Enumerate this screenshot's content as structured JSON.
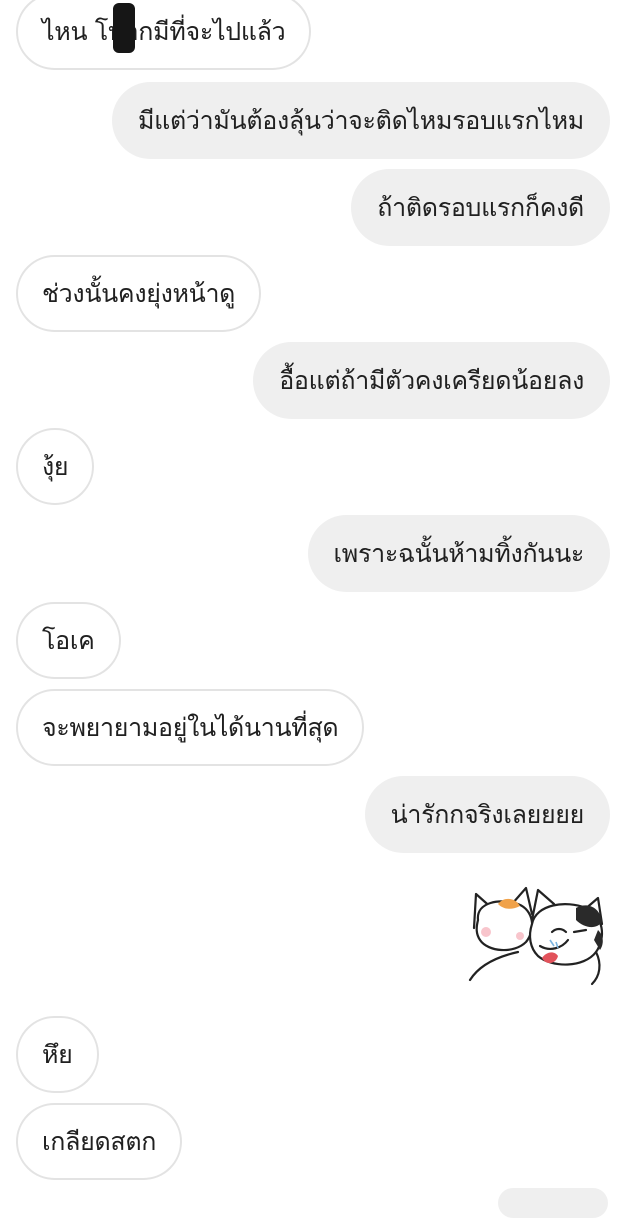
{
  "messages": [
    {
      "side": "in",
      "text": "ไหน โบอกมีที่จะไปแล้ว"
    },
    {
      "side": "out",
      "text": "มีแต่ว่ามันต้องลุ้นว่าจะติดไหมรอบแรกไหม"
    },
    {
      "side": "out",
      "text": "ถ้าติดรอบแรกก็คงดี"
    },
    {
      "side": "in",
      "text": "ช่วงนั้นคงยุ่งหน้าดู"
    },
    {
      "side": "out",
      "text": "อื้อแต่ถ้ามีตัวคงเครียดน้อยลง"
    },
    {
      "side": "in",
      "text": "งุ้ย"
    },
    {
      "side": "out",
      "text": "เพราะฉนั้นห้ามทิ้งกันนะ"
    },
    {
      "side": "in",
      "text": "โอเค"
    },
    {
      "side": "in",
      "text": "จะพยายามอยู่ในได้นานที่สุด"
    },
    {
      "side": "out",
      "text": "น่ารักกจริงเลยยยย"
    },
    {
      "side": "in",
      "text": "หึย"
    },
    {
      "side": "in",
      "text": "เกลียดสตก"
    }
  ],
  "sticker": {
    "icon": "cat-hug-sticker-icon",
    "side": "out"
  },
  "colors": {
    "incoming_bg": "#ffffff",
    "incoming_border": "#e3e3e3",
    "outgoing_bg": "#efefef",
    "text": "#202020"
  }
}
